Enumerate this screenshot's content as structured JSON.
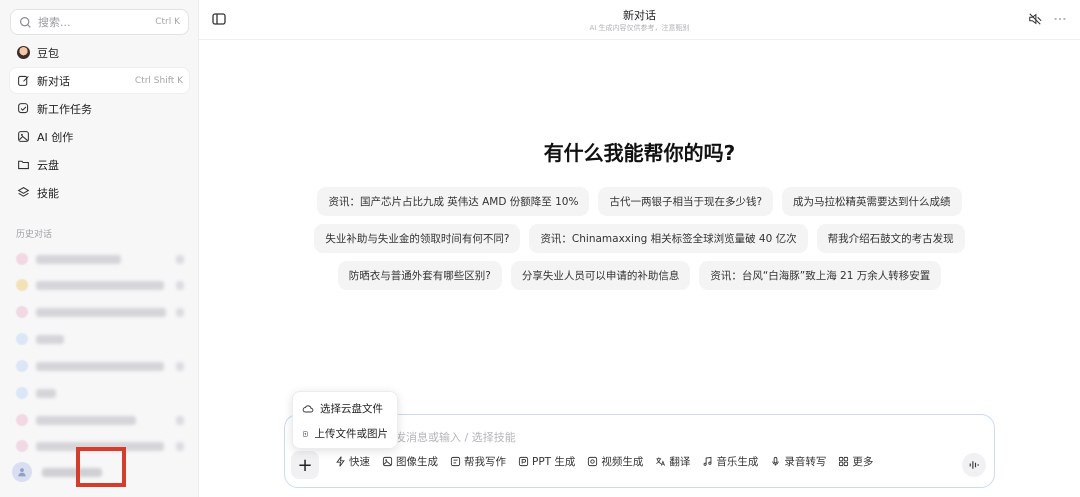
{
  "sidebar": {
    "search": {
      "placeholder": "搜索...",
      "shortcut": "Ctrl K"
    },
    "items": [
      {
        "label": "豆包",
        "icon": "doubao-avatar-icon"
      },
      {
        "label": "新对话",
        "icon": "new-chat-icon",
        "shortcut": "Ctrl Shift K",
        "active": true
      },
      {
        "label": "新工作任务",
        "icon": "task-icon"
      },
      {
        "label": "AI 创作",
        "icon": "image-create-icon"
      },
      {
        "label": "云盘",
        "icon": "folder-icon"
      },
      {
        "label": "技能",
        "icon": "layers-icon"
      }
    ],
    "history_title": "历史对话"
  },
  "header": {
    "title": "新对话",
    "subtitle": "AI 生成内容仅供参考，注意甄别"
  },
  "main": {
    "hero": "有什么我能帮你的吗?",
    "suggestions": [
      [
        "资讯：国产芯片占比九成 英伟达 AMD 份额降至 10%",
        "古代一两银子相当于现在多少钱?",
        "成为马拉松精英需要达到什么成绩"
      ],
      [
        "失业补助与失业金的领取时间有何不同?",
        "资讯：Chinamaxxing 相关标签全球浏览量破 40 亿次",
        "帮我介绍石鼓文的考古发现"
      ],
      [
        "防晒衣与普通外套有哪些区别?",
        "分享失业人员可以申请的补助信息",
        "资讯：台风“白海豚”致上海 21 万余人转移安置"
      ]
    ]
  },
  "composer": {
    "placeholder": "发消息或输入 / 选择技能",
    "popup": [
      "选择云盘文件",
      "上传文件或图片"
    ],
    "tools": [
      {
        "label": "快速",
        "icon": "lightning-icon"
      },
      {
        "label": "图像生成",
        "icon": "image-icon"
      },
      {
        "label": "帮我写作",
        "icon": "write-icon"
      },
      {
        "label": "PPT 生成",
        "icon": "ppt-icon"
      },
      {
        "label": "视频生成",
        "icon": "video-icon"
      },
      {
        "label": "翻译",
        "icon": "translate-icon"
      },
      {
        "label": "音乐生成",
        "icon": "music-icon"
      },
      {
        "label": "录音转写",
        "icon": "mic-icon"
      },
      {
        "label": "更多",
        "icon": "grid-icon"
      }
    ]
  },
  "colors": {
    "highlight": "#d33d2b",
    "accent": "#c9dcf3"
  }
}
